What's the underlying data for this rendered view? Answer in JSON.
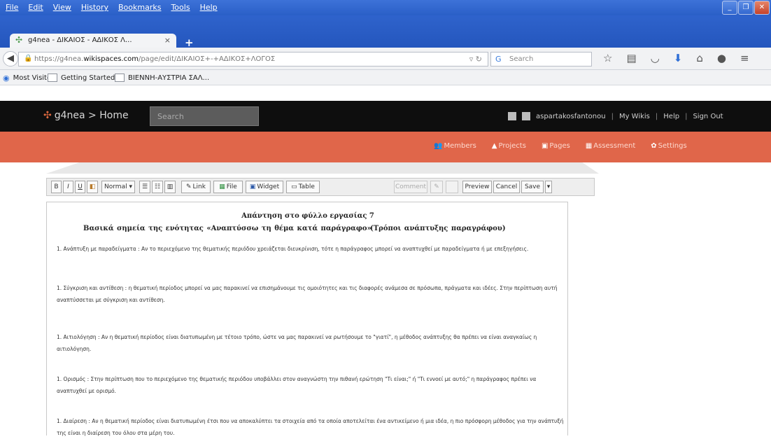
{
  "menu": [
    "File",
    "Edit",
    "View",
    "History",
    "Bookmarks",
    "Tools",
    "Help"
  ],
  "tab": {
    "title": "g4nea - ΔΙΚΑΙΟΣ - ΑΔΙΚΟΣ Λ...",
    "close": "×"
  },
  "newtab": "+",
  "url": {
    "prefix": "https://g4nea.",
    "host": "wikispaces.com",
    "path": "/page/edit/ΔΙΚΑΙΟΣ+-+ΑΔΙΚΟΣ+ΛΟΓΟΣ"
  },
  "search_placeholder": "Search",
  "bookmarks": [
    "Most Visited",
    "Getting Started",
    "ΒΙΕΝΝΗ-ΑΥΣΤΡΙΑ ΣΑΛ..."
  ],
  "wiki": {
    "brand": "g4nea > Home",
    "search_placeholder": "Search",
    "user": "aspartakosfantonou",
    "links": [
      "My Wikis",
      "Help",
      "Sign Out"
    ],
    "nav": [
      "Members",
      "Projects",
      "Pages",
      "Assessment",
      "Settings"
    ]
  },
  "toolbar": {
    "bold": "B",
    "italic": "I",
    "underline": "U",
    "style": "Normal",
    "link": "Link",
    "file": "File",
    "widget": "Widget",
    "table": "Table",
    "comment": "Comment",
    "preview": "Preview",
    "cancel": "Cancel",
    "save": "Save"
  },
  "document": {
    "title": "Απάντηση στο φύλλο εργασίας 7",
    "subtitle": "Βασικά σημεία της ενότητας «Αναπτύσσω τη θέμα κατά παράγραφο»",
    "subtitle2": "(Τρόποι ανάπτυξης παραγράφου)",
    "paragraphs": [
      "1. Ανάπτυξη με παραδείγματα : Αν το περιεχόμενο της θεματικής περιόδου χρειάζεται διευκρίνιση, τότε η παράγραφος μπορεί να αναπτυχθεί με παραδείγματα ή με επεξηγήσεις.",
      "1. Σύγκριση και αντίθεση : η θεματική περίοδος μπορεί να μας παρακινεί να επισημάνουμε τις ομοιότητες και τις διαφορές ανάμεσα σε πρόσωπα, πράγματα και ιδέες. Στην περίπτωση αυτή αναπτύσσεται με σύγκριση και αντίθεση.",
      "1. Αιτιολόγηση : Αν η θεματική περίοδος είναι διατυπωμένη με τέτοιο τρόπο, ώστε να μας παρακινεί να ρωτήσουμε το \"γιατί\", η μέθοδος ανάπτυξης θα πρέπει να είναι αναγκαίως η αιτιολόγηση.",
      "1. Ορισμός : Στην περίπτωση που το περιεχόμενο της θεματικής περιόδου υποβάλλει στον αναγνώστη την πιθανή ερώτηση \"Τι είναι;\" ή \"Τι εννοεί με αυτό;\" η παράγραφος πρέπει να αναπτυχθεί με ορισμό.",
      "1. Διαίρεση : Αν η θεματική περίοδος είναι διατυπωμένη έτσι που να αποκαλύπτει τα στοιχεία από τα οποία αποτελείται ένα αντικείμενο ή μια ιδέα, η πιο πρόσφορη μέθοδος για την ανάπτυξή της είναι η διαίρεση του όλου στα μέρη του."
    ]
  }
}
